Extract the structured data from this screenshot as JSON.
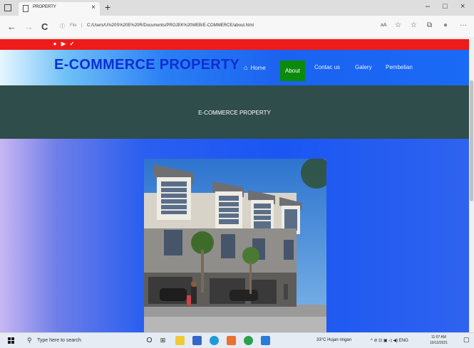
{
  "browser": {
    "tab_title": "PROPERTY",
    "tab_close": "×",
    "new_tab": "+",
    "window_controls": {
      "minimize": "–",
      "maximize": "□",
      "close": "×"
    },
    "nav": {
      "back": "←",
      "forward": "→",
      "refresh": "C"
    },
    "address": {
      "info_icon": "ⓘ",
      "scheme_label": "File",
      "separator": "|",
      "url": "C:/Users/U%20S%20E%20R/Documents/PROJEK%20WEB/E-COMMERCE/about.html"
    },
    "toolbar_icons": [
      "aA",
      "☆",
      "☆",
      "⧉",
      "●",
      "···"
    ]
  },
  "site": {
    "colors": {
      "top_bar": "#ee1b1b",
      "brand": "#0d2fd4",
      "active_nav": "#0c8a0c",
      "banner": "#2f4d4a"
    },
    "social": [
      "●",
      "▶",
      "✓"
    ],
    "brand": "E-COMMERCE PROPERTY",
    "nav": [
      {
        "label": "Home",
        "icon": "⌂"
      },
      {
        "label": "About"
      },
      {
        "label": "Contac us"
      },
      {
        "label": "Galery"
      },
      {
        "label": "Pembelian"
      }
    ],
    "banner_title": "E-COMMERCE PROPERTY"
  },
  "taskbar": {
    "search_placeholder": "Type here to search",
    "weather": "33°C  Hujan ringan",
    "tray_icons": "^  ⊘  ⊡  ▣  ◁  ◀)  ENG",
    "time": "11:07 AM",
    "date": "10/12/2021"
  }
}
